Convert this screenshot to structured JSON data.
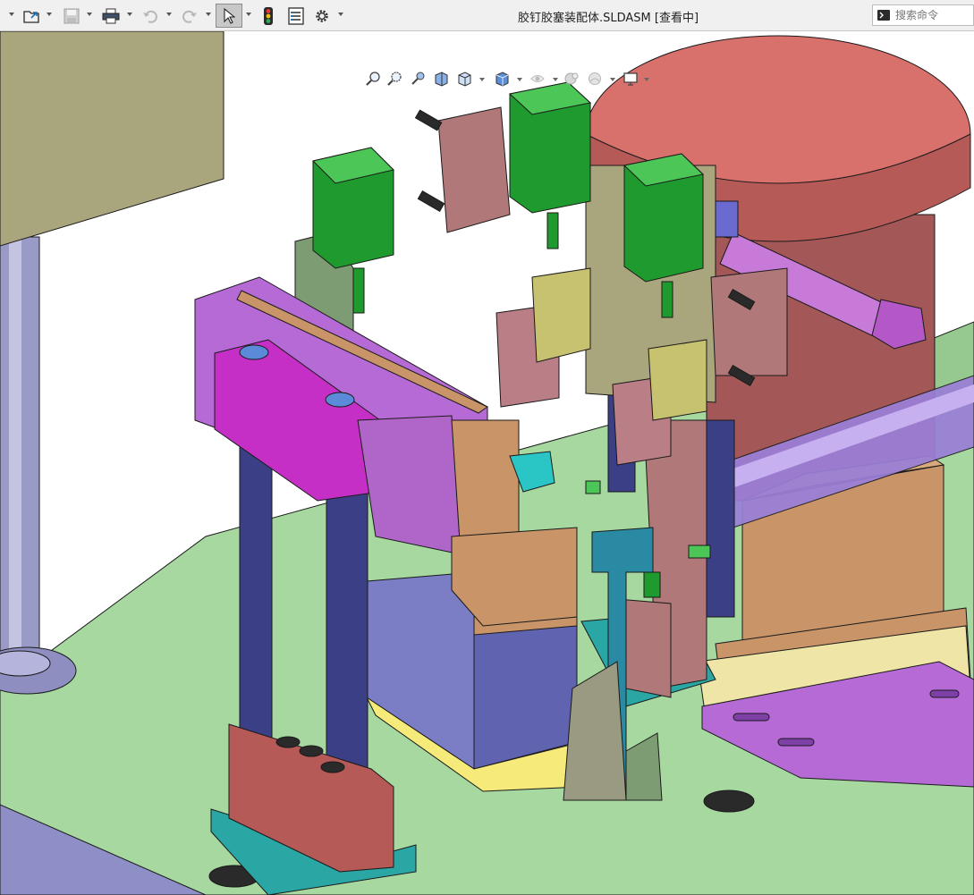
{
  "window": {
    "title": "胶钉胶塞装配体.SLDASM [查看中]"
  },
  "command_search": {
    "placeholder": "搜索命令"
  },
  "toolbar": {
    "icons": [
      "new-dropdown",
      "open-file-icon",
      "save-icon",
      "print-icon",
      "undo-icon",
      "redo-icon",
      "select-pointer-icon",
      "rebuild-traffic-light-icon",
      "file-properties-icon",
      "options-gear-icon"
    ]
  },
  "heads_up_toolbar": {
    "icons": [
      "zoom-to-fit-icon",
      "zoom-to-area-icon",
      "previous-view-icon",
      "section-view-icon",
      "view-orientation-icon",
      "display-style-icon",
      "hide-show-items-icon",
      "edit-appearance-icon",
      "apply-scene-icon",
      "view-settings-icon"
    ]
  },
  "colors": {
    "background": "#ffffff",
    "floor": "#a6d8a0",
    "green_cylinder": "#1f9a2e",
    "magenta_block": "#c62fc6",
    "violet_plate": "#b66ad6",
    "salmon_disk": "#d8706c",
    "navy_column": "#3a3f86",
    "teal_plate": "#2aa6a4",
    "tan_block": "#c89468",
    "olive_panel": "#a9a57c",
    "yellow_plate": "#f6ea7a",
    "slate_block": "#7b7ec4",
    "mauve_bracket": "#b07878"
  }
}
